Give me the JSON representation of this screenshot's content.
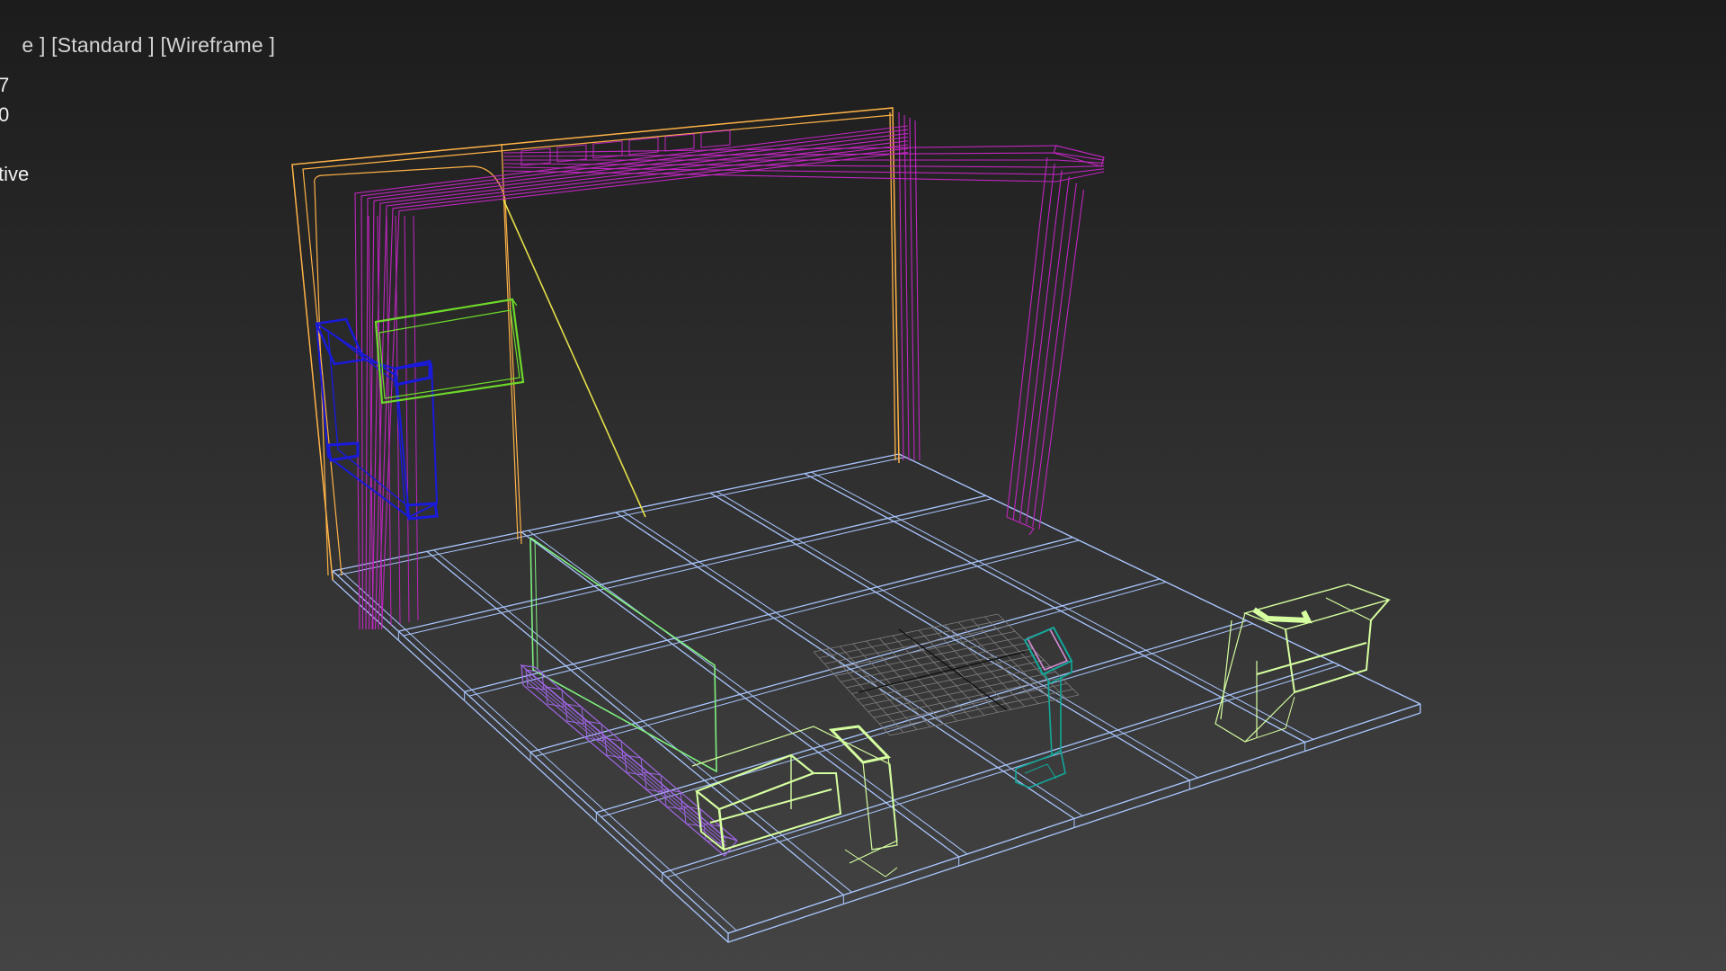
{
  "viewport": {
    "label_parts": [
      "e ]",
      " [Standard ]",
      " [Wireframe ]"
    ],
    "stats": [
      "7",
      "0",
      "tive"
    ]
  },
  "colors": {
    "floor": "#a9c6ff",
    "wall_outer": "#ffb347",
    "wall_inner": "#c026c0",
    "blue_panel": "#1a1adc",
    "green_frame": "#6ed92a",
    "light_green": "#d6ffa0",
    "violet_bench": "#a066e6",
    "teal_kiosk": "#12a89a",
    "yellow_diag": "#e6e04a",
    "grid_patch": "#7f7f7f",
    "glass": "#7ff07f"
  },
  "icons": [
    "no icons visible"
  ]
}
